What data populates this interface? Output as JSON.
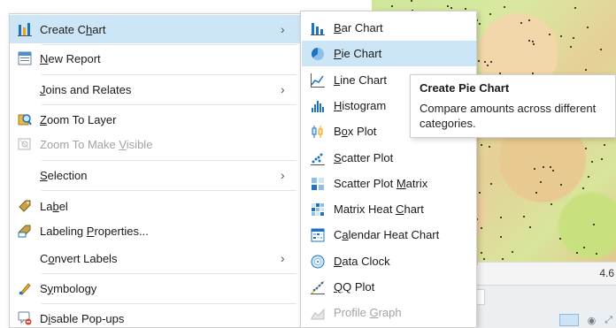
{
  "context_menu": {
    "items": [
      {
        "label_pre": "Create C",
        "label_u": "h",
        "label_post": "art",
        "icon": "create-chart-icon",
        "has_submenu": true,
        "highlighted": true
      },
      {
        "label_pre": "",
        "label_u": "N",
        "label_post": "ew Report",
        "icon": "new-report-icon",
        "has_submenu": false
      },
      {
        "label_pre": "",
        "label_u": "J",
        "label_post": "oins and Relates",
        "icon": "",
        "has_submenu": true
      },
      {
        "label_pre": "",
        "label_u": "Z",
        "label_post": "oom To Layer",
        "icon": "zoom-to-layer-icon",
        "has_submenu": false
      },
      {
        "label_pre": "Zoom To Make ",
        "label_u": "V",
        "label_post": "isible",
        "icon": "zoom-to-visible-icon",
        "has_submenu": false,
        "disabled": true
      },
      {
        "label_pre": "",
        "label_u": "S",
        "label_post": "election",
        "icon": "",
        "has_submenu": true
      },
      {
        "label_pre": "La",
        "label_u": "b",
        "label_post": "el",
        "icon": "label-icon",
        "has_submenu": false
      },
      {
        "label_pre": "Labeling ",
        "label_u": "P",
        "label_post": "roperties...",
        "icon": "labeling-properties-icon",
        "has_submenu": false
      },
      {
        "label_pre": "C",
        "label_u": "o",
        "label_post": "nvert Labels",
        "icon": "",
        "has_submenu": true
      },
      {
        "label_pre": "S",
        "label_u": "y",
        "label_post": "mbology",
        "icon": "symbology-icon",
        "has_submenu": false
      },
      {
        "label_pre": "D",
        "label_u": "i",
        "label_post": "sable Pop-ups",
        "icon": "disable-popups-icon",
        "has_submenu": false
      }
    ],
    "arrow": "›"
  },
  "chart_submenu": {
    "items": [
      {
        "label_pre": "",
        "label_u": "B",
        "label_post": "ar Chart",
        "icon": "bar-chart-icon"
      },
      {
        "label_pre": "",
        "label_u": "P",
        "label_post": "ie Chart",
        "icon": "pie-chart-icon",
        "highlighted": true
      },
      {
        "label_pre": "",
        "label_u": "L",
        "label_post": "ine Chart",
        "icon": "line-chart-icon"
      },
      {
        "label_pre": "",
        "label_u": "H",
        "label_post": "istogram",
        "icon": "histogram-icon"
      },
      {
        "label_pre": "B",
        "label_u": "o",
        "label_post": "x Plot",
        "icon": "box-plot-icon"
      },
      {
        "label_pre": "",
        "label_u": "S",
        "label_post": "catter Plot",
        "icon": "scatter-plot-icon"
      },
      {
        "label_pre": "Scatter Plot ",
        "label_u": "M",
        "label_post": "atrix",
        "icon": "scatter-plot-matrix-icon"
      },
      {
        "label_pre": "Matrix Heat ",
        "label_u": "C",
        "label_post": "hart",
        "icon": "matrix-heat-chart-icon"
      },
      {
        "label_pre": "C",
        "label_u": "a",
        "label_post": "lendar Heat Chart",
        "icon": "calendar-heat-chart-icon"
      },
      {
        "label_pre": "",
        "label_u": "D",
        "label_post": "ata Clock",
        "icon": "data-clock-icon"
      },
      {
        "label_pre": "",
        "label_u": "Q",
        "label_post": "Q Plot",
        "icon": "qq-plot-icon"
      },
      {
        "label_pre": "Profile ",
        "label_u": "G",
        "label_post": "raph",
        "icon": "profile-graph-icon",
        "disabled": true
      }
    ]
  },
  "tooltip": {
    "title": "Create Pie Chart",
    "body": "Compare amounts across different categories."
  },
  "map": {
    "scale_readout": "4.6",
    "tools": [
      "⬚",
      "◉",
      "⤢"
    ]
  },
  "colors": {
    "highlight": "#cde6f7",
    "accent_blue": "#1e73be",
    "disabled_text": "#a3a3a3"
  }
}
